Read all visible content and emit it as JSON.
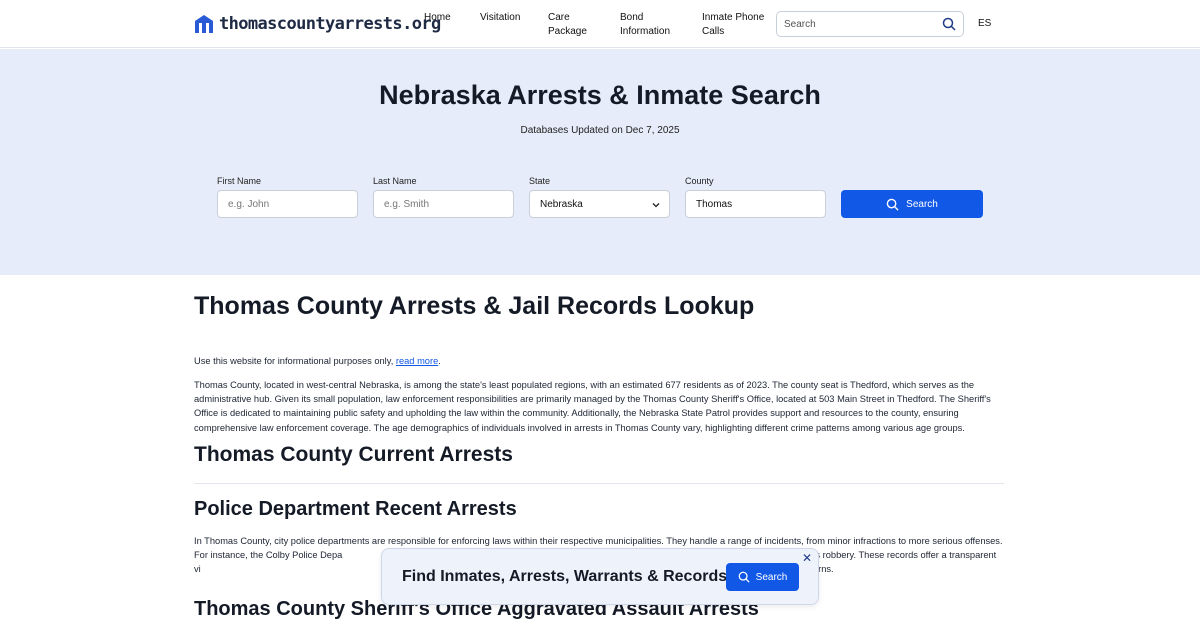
{
  "header": {
    "logo_text": "thomascountyarrests.org",
    "nav": [
      {
        "label": "Home"
      },
      {
        "label": "Visitation"
      },
      {
        "label": "Care\nPackage"
      },
      {
        "label": "Bond\nInformation"
      },
      {
        "label": "Inmate Phone\nCalls"
      }
    ],
    "search_placeholder": "Search",
    "language": "ES"
  },
  "hero": {
    "title": "Nebraska Arrests & Inmate Search",
    "subtitle": "Databases Updated on Dec 7, 2025",
    "form": {
      "first_name_label": "First Name",
      "first_name_placeholder": "e.g. John",
      "last_name_label": "Last Name",
      "last_name_placeholder": "e.g. Smith",
      "state_label": "State",
      "state_value": "Nebraska",
      "county_label": "County",
      "county_value": "Thomas",
      "search_label": "Search"
    }
  },
  "content": {
    "title": "Thomas County Arrests & Jail Records Lookup",
    "disclaimer_prefix": "Use this website for informational purposes only, ",
    "disclaimer_link": "read more",
    "disclaimer_suffix": ".",
    "intro": "Thomas County, located in west-central Nebraska, is among the state's least populated regions, with an estimated 677 residents as of 2023. The county seat is Thedford, which serves as the administrative hub. Given its small population, law enforcement responsibilities are primarily managed by the Thomas County Sheriff's Office, located at 503 Main Street in Thedford. The Sheriff's Office is dedicated to maintaining public safety and upholding the law within the community. Additionally, the Nebraska State Patrol provides support and resources to the county, ensuring comprehensive law enforcement coverage. The age demographics of individuals involved in arrests in Thomas County vary, highlighting different crime patterns among various age groups.",
    "current_arrests_heading": "Thomas County Current Arrests",
    "police_heading": "Police Department Recent Arrests",
    "police_paragraph": "In Thomas County, city police departments are responsible for enforcing laws within their respective municipalities. They handle a range of incidents, from minor infractions to more serious offenses. For instance, the Colby Police Depa                                                                                                                              lations, and serious offenses such as robbery. These records offer a transparent vi                                                                                                                                            ccess these updates to stay informed about local safety concerns.",
    "sheriff_heading": "Thomas County Sheriff's Office Aggravated Assault Arrests"
  },
  "banner": {
    "text": "Find Inmates, Arrests, Warrants & Records",
    "button_label": "Search",
    "close_symbol": "✕"
  },
  "colors": {
    "accent": "#1158e6",
    "hero_bg": "#e6ecf9",
    "heading": "#141a26"
  }
}
